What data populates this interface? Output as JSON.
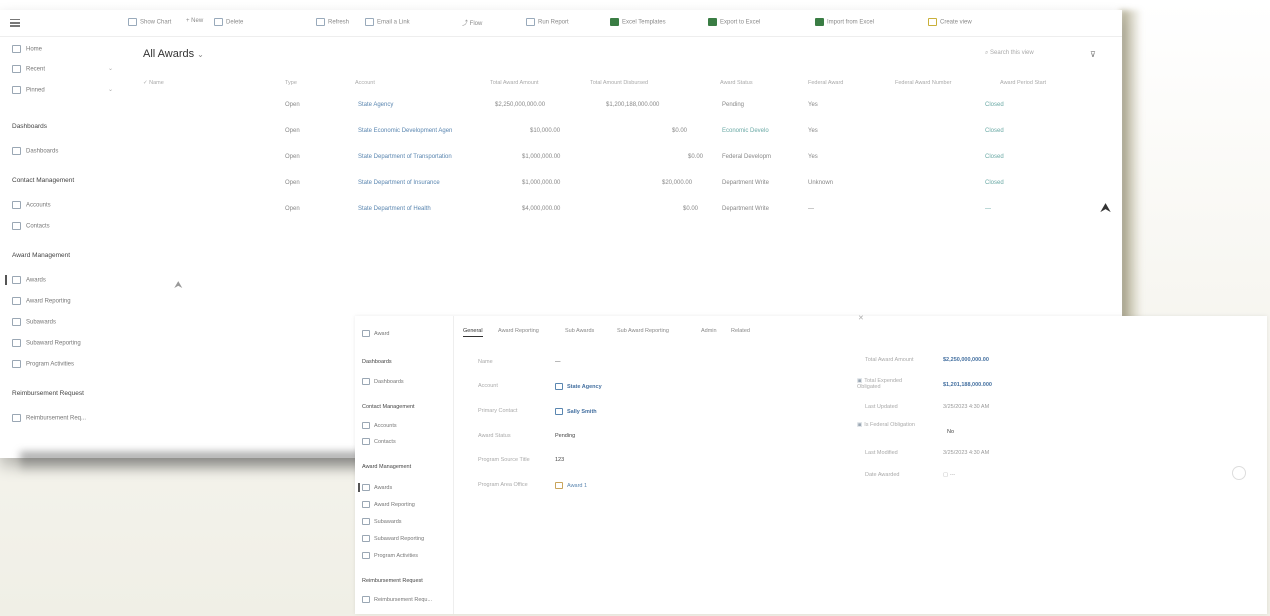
{
  "main": {
    "toolbar": [
      {
        "label": "Show Chart",
        "icon": "chart-icon"
      },
      {
        "label": "New",
        "icon": "plus-icon"
      },
      {
        "label": "Delete",
        "icon": "trash-icon"
      },
      {
        "label": "Refresh",
        "icon": "refresh-icon"
      },
      {
        "label": "Email a Link",
        "icon": "mail-icon"
      },
      {
        "label": "Flow",
        "icon": "flow-icon"
      },
      {
        "label": "Run Report",
        "icon": "report-icon"
      },
      {
        "label": "Excel Templates",
        "icon": "excel-icon"
      },
      {
        "label": "Export to Excel",
        "icon": "excel-export-icon"
      },
      {
        "label": "Import from Excel",
        "icon": "excel-import-icon"
      },
      {
        "label": "Create view",
        "icon": "filter-icon"
      }
    ],
    "nav": {
      "top": [
        "Home",
        "Recent",
        "Pinned"
      ],
      "sections": [
        {
          "title": "Dashboards",
          "items": [
            "Dashboards"
          ]
        },
        {
          "title": "Contact Management",
          "items": [
            "Accounts",
            "Contacts"
          ]
        },
        {
          "title": "Award Management",
          "items": [
            "Awards",
            "Award Reporting",
            "Subawards",
            "Subaward Reporting",
            "Program Activities"
          ]
        },
        {
          "title": "Reimbursement Request",
          "items": [
            "Reimbursement Req..."
          ]
        }
      ]
    },
    "view_title": "All Awards",
    "search_placeholder": "Search this view",
    "columns": [
      "Name",
      "Type",
      "Account",
      "Total Award Amount",
      "Total Amount Disbursed",
      "Award Status",
      "Federal Award",
      "Federal Award Number",
      "Award Period Start"
    ],
    "rows": [
      {
        "type": "Open",
        "account": "State Agency",
        "amount": "$2,250,000,000.00",
        "disbursed": "$1,200,188,000.000",
        "status": "Pending",
        "federal": "Yes",
        "link": "Closed"
      },
      {
        "type": "Open",
        "account": "State Economic Development Agen",
        "amount": "$10,000.00",
        "disbursed": "$0.00",
        "status": "Economic Develo",
        "federal": "Yes",
        "link": "Closed"
      },
      {
        "type": "Open",
        "account": "State Department of Transportation",
        "amount": "$1,000,000.00",
        "disbursed": "$0.00",
        "status": "Federal Developm",
        "federal": "Yes",
        "link": "Closed"
      },
      {
        "type": "Open",
        "account": "State Department of Insurance",
        "amount": "$1,000,000.00",
        "disbursed": "$20,000.00",
        "status": "Department Write",
        "federal": "Unknown",
        "link": "Closed"
      },
      {
        "type": "Open",
        "account": "State Department of Health",
        "amount": "$4,000,000.00",
        "disbursed": "$0.00",
        "status": "Department Write",
        "federal": "—",
        "link": "—"
      }
    ]
  },
  "form": {
    "nav_back": "Award",
    "nav": {
      "sections": [
        {
          "title": "Dashboards",
          "items": [
            "Dashboards"
          ]
        },
        {
          "title": "Contact Management",
          "items": [
            "Accounts",
            "Contacts"
          ]
        },
        {
          "title": "Award Management",
          "items": [
            "Awards",
            "Award Reporting",
            "Subawards",
            "Subaward Reporting",
            "Program Activities"
          ]
        },
        {
          "title": "Reimbursement Request",
          "items": [
            "Reimbursement Requ..."
          ]
        }
      ]
    },
    "tabs": [
      "General",
      "Award Reporting",
      "Sub Awards",
      "Sub Award Reporting",
      "Admin",
      "Related"
    ],
    "left_fields": [
      {
        "label": "Name",
        "value": "—"
      },
      {
        "label": "Account",
        "value": "State Agency"
      },
      {
        "label": "Primary Contact",
        "value": "Sally Smith"
      },
      {
        "label": "Award Status",
        "value": "Pending"
      },
      {
        "label": "Program Source Title",
        "value": "123"
      },
      {
        "label": "Program Area Office",
        "value": "Award 1"
      }
    ],
    "right_fields": [
      {
        "label": "Total Award Amount",
        "value": "$2,250,000,000.00"
      },
      {
        "label": "Total Expended Obligated",
        "value": "$1,201,188,000.000"
      },
      {
        "label": "Last Updated",
        "value": "3/25/2023 4:30 AM"
      },
      {
        "label": "Is Federal Obligation",
        "value": "No"
      },
      {
        "label": "Last Modified",
        "value": "3/25/2023 4:30 AM"
      },
      {
        "label": "Date Awarded",
        "value": "---"
      }
    ]
  }
}
